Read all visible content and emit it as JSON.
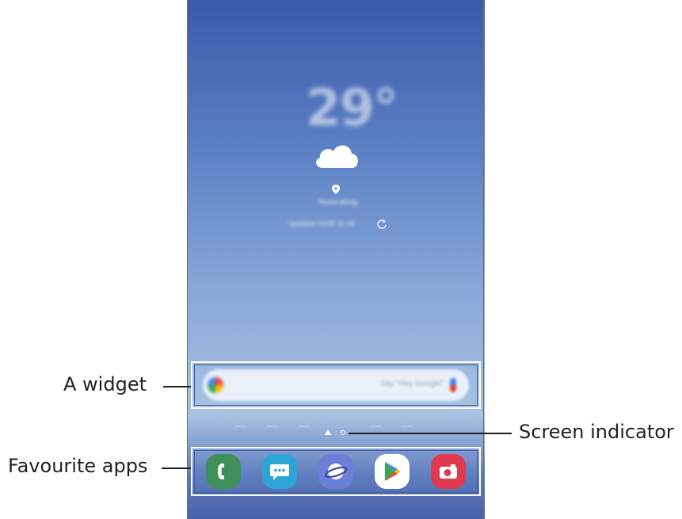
{
  "callouts": {
    "widget": "A widget",
    "favourite_apps": "Favourite apps",
    "screen_indicator": "Screen indicator"
  },
  "home_screen": {
    "weather": {
      "temperature": "29°",
      "location": "Yeoui-dong",
      "updated": "Updated 01/08 11:18"
    },
    "search_widget": {
      "hint": "Say \"Hey Google\""
    },
    "screen_indicator": {
      "pages": 2,
      "current": 1
    },
    "favourite_apps": [
      {
        "name": "Phone",
        "icon": "phone-icon",
        "color": "#3f8f5b"
      },
      {
        "name": "Messages",
        "icon": "messages-icon",
        "color": "#2ea3d6"
      },
      {
        "name": "Internet",
        "icon": "internet-icon",
        "color": "#6b7fd6"
      },
      {
        "name": "Play Store",
        "icon": "play-store-icon",
        "color": "#ffffff"
      },
      {
        "name": "Camera",
        "icon": "camera-icon",
        "color": "#e03a4f"
      }
    ]
  }
}
